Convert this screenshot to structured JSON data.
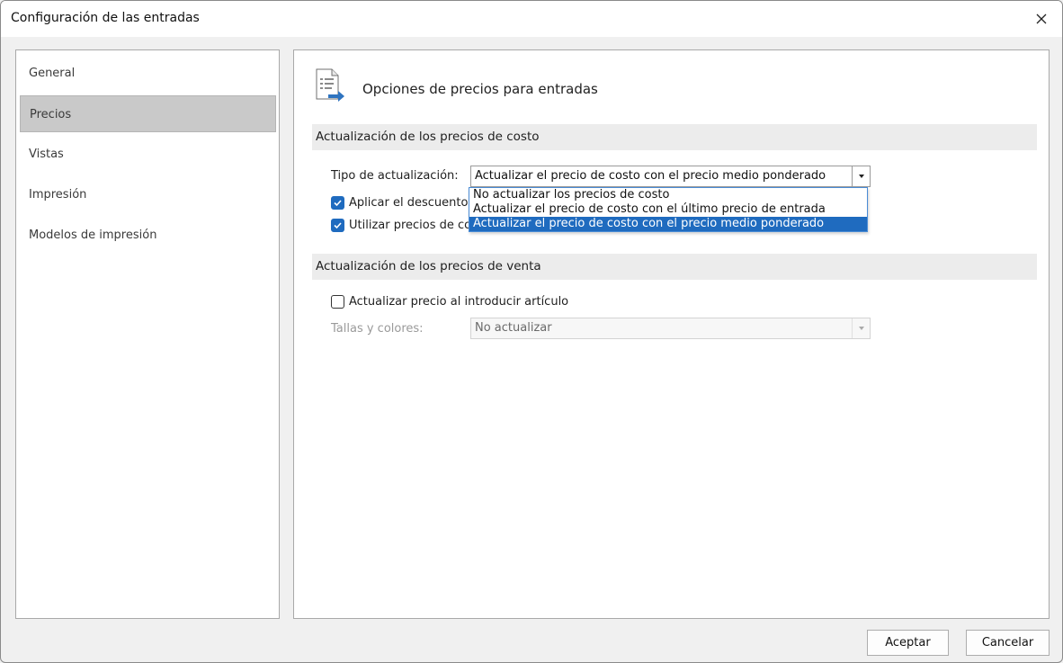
{
  "window": {
    "title": "Configuración de las entradas",
    "close_label": "×"
  },
  "sidebar": {
    "items": [
      {
        "label": "General",
        "selected": false
      },
      {
        "label": "Precios",
        "selected": true
      },
      {
        "label": "Vistas",
        "selected": false
      },
      {
        "label": "Impresión",
        "selected": false
      },
      {
        "label": "Modelos de impresión",
        "selected": false
      }
    ]
  },
  "content": {
    "header_title": "Opciones de precios para entradas",
    "cost_section": {
      "title": "Actualización de los precios de costo",
      "update_type_label": "Tipo de actualización:",
      "update_type_value": "Actualizar el precio de costo con el precio medio ponderado",
      "checkbox_discount_label": "Aplicar el descuento",
      "checkbox_discount_checked": true,
      "checkbox_use_prices_label": "Utilizar precios de co",
      "checkbox_use_prices_checked": true
    },
    "dropdown": {
      "options": [
        "No actualizar los precios de costo",
        "Actualizar el precio de costo con el último precio de entrada",
        "Actualizar el precio de costo con el precio medio ponderado"
      ],
      "highlighted_index": 2
    },
    "sale_section": {
      "title": "Actualización de los precios de venta",
      "checkbox_update_label": "Actualizar precio al introducir artículo",
      "checkbox_update_checked": false,
      "sizes_colors_label": "Tallas y colores:",
      "sizes_colors_value": "No actualizar"
    }
  },
  "footer": {
    "accept_label": "Aceptar",
    "cancel_label": "Cancelar"
  },
  "colors": {
    "accent": "#1f6bbf",
    "selected_item": "#c9c9c9"
  }
}
